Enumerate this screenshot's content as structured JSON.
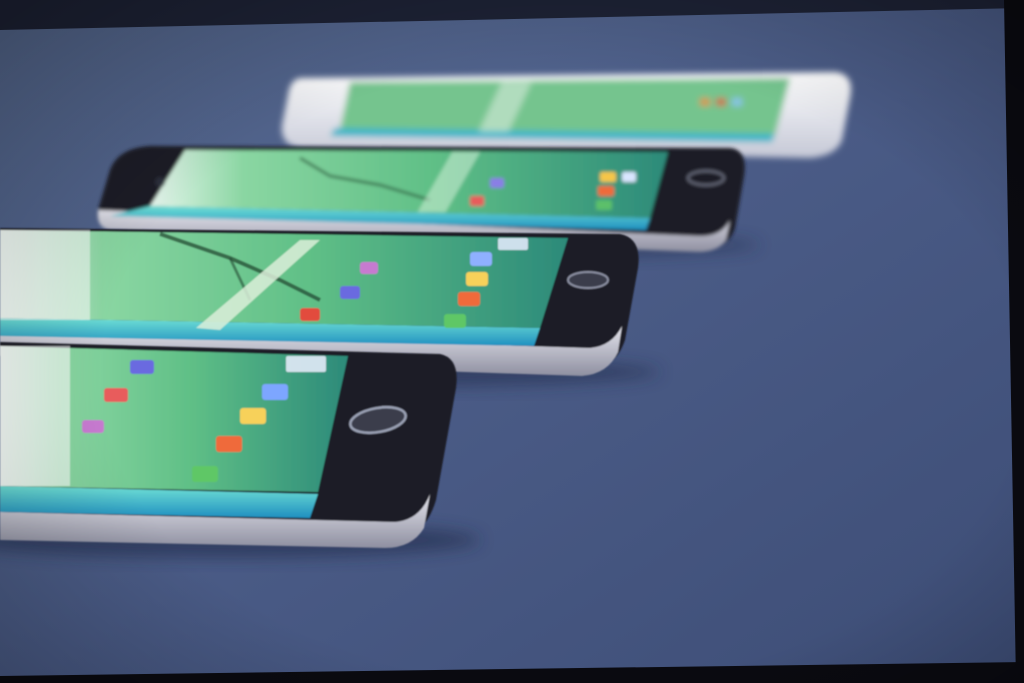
{
  "image": {
    "subject": "",
    "colors": {
      "table": "#4a5b86",
      "table_dark": "#39476b",
      "table_light": "#5a6d9a",
      "screen_green": "#63c28a",
      "screen_teal": "#3fb7b3",
      "edge_blue": "#2bb0d8",
      "frame_silver": "#c9c9d3",
      "frame_dark": "#1b1d28",
      "white_phone": "#e8eaf0"
    },
    "phones": [
      {
        "id": "phone-1",
        "finish": "white"
      },
      {
        "id": "phone-2",
        "finish": "black"
      },
      {
        "id": "phone-3",
        "finish": "black"
      },
      {
        "id": "phone-4",
        "finish": "black"
      }
    ]
  }
}
